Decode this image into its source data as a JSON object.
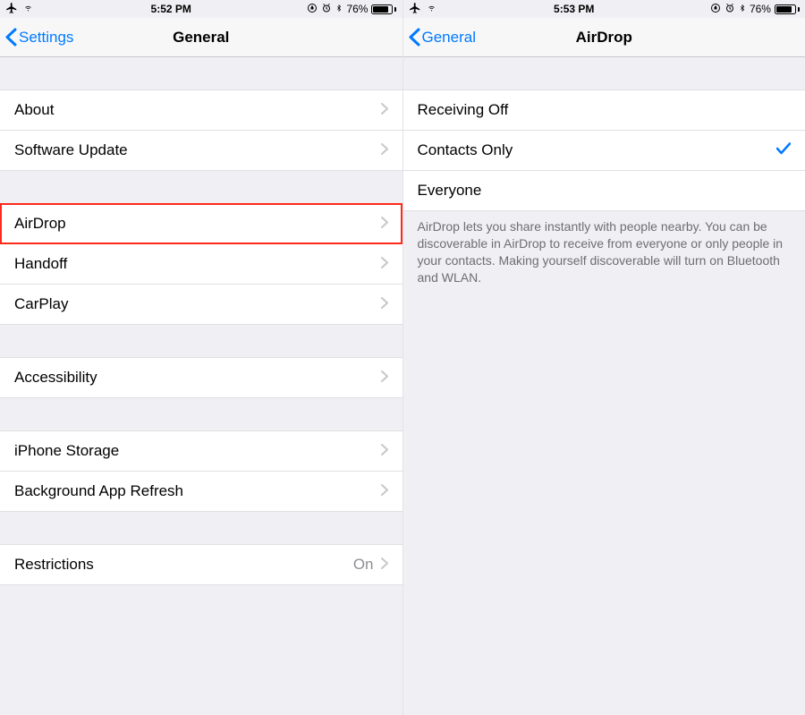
{
  "left": {
    "status": {
      "time": "5:52 PM",
      "battery_pct": "76%"
    },
    "nav": {
      "back": "Settings",
      "title": "General"
    },
    "groups": [
      [
        {
          "label": "About"
        },
        {
          "label": "Software Update"
        }
      ],
      [
        {
          "label": "AirDrop",
          "highlight": true
        },
        {
          "label": "Handoff"
        },
        {
          "label": "CarPlay"
        }
      ],
      [
        {
          "label": "Accessibility"
        }
      ],
      [
        {
          "label": "iPhone Storage"
        },
        {
          "label": "Background App Refresh"
        }
      ],
      [
        {
          "label": "Restrictions",
          "detail": "On"
        }
      ]
    ]
  },
  "right": {
    "status": {
      "time": "5:53 PM",
      "battery_pct": "76%"
    },
    "nav": {
      "back": "General",
      "title": "AirDrop"
    },
    "options": [
      {
        "label": "Receiving Off",
        "selected": false
      },
      {
        "label": "Contacts Only",
        "selected": true
      },
      {
        "label": "Everyone",
        "selected": false
      }
    ],
    "footer": "AirDrop lets you share instantly with people nearby. You can be discoverable in AirDrop to receive from everyone or only people in your contacts. Making yourself discoverable will turn on Bluetooth and WLAN."
  }
}
